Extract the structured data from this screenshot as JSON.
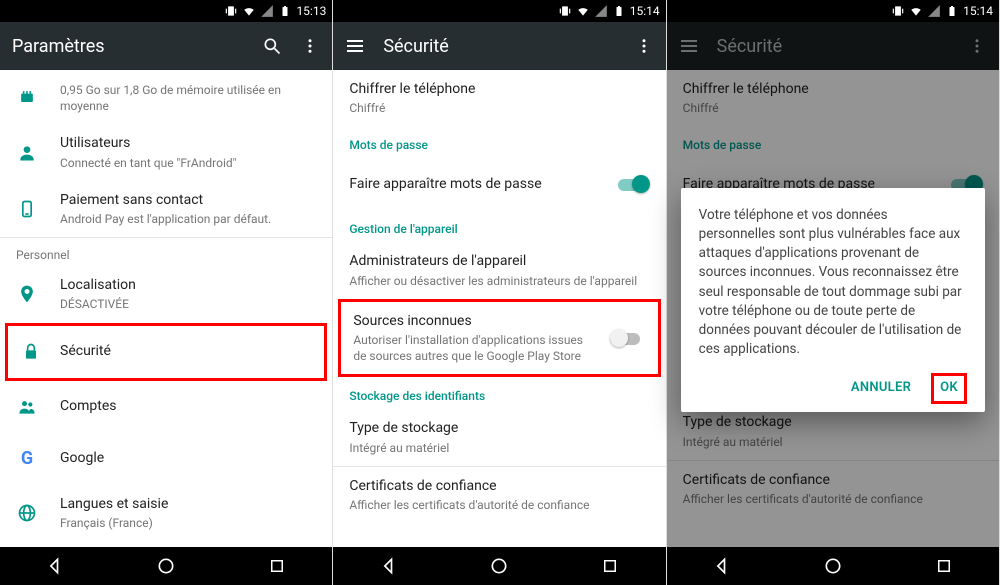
{
  "status": {
    "time1": "15:13",
    "time2": "15:14",
    "time3": "15:14"
  },
  "phone1": {
    "appbar_title": "Paramètres",
    "memory_sub": "0,95 Go sur 1,8 Go de mémoire utilisée en moyenne",
    "users_title": "Utilisateurs",
    "users_sub": "Connecté en tant que \"FrAndroid\"",
    "nfc_title": "Paiement sans contact",
    "nfc_sub": "Android Pay est l'application par défaut.",
    "section_personnel": "Personnel",
    "location_title": "Localisation",
    "location_sub": "DÉSACTIVÉE",
    "security_title": "Sécurité",
    "accounts_title": "Comptes",
    "google_title": "Google",
    "lang_title": "Langues et saisie",
    "lang_sub": "Français (France)"
  },
  "phone2": {
    "appbar_title": "Sécurité",
    "encrypt_title": "Chiffrer le téléphone",
    "encrypt_sub": "Chiffré",
    "section_passwords": "Mots de passe",
    "showpw_title": "Faire apparaître mots de passe",
    "section_admin": "Gestion de l'appareil",
    "admins_title": "Administrateurs de l'appareil",
    "admins_sub": "Afficher ou désactiver les administrateurs de l'appareil",
    "unknown_title": "Sources inconnues",
    "unknown_sub": "Autoriser l'installation d'applications issues de sources autres que le Google Play Store",
    "section_creds": "Stockage des identifiants",
    "storage_title": "Type de stockage",
    "storage_sub": "Intégré au matériel",
    "certs_title": "Certificats de confiance",
    "certs_sub": "Afficher les certificats d'autorité de confiance"
  },
  "phone3": {
    "appbar_title": "Sécurité",
    "dialog_text": "Votre téléphone et vos données personnelles sont plus vulnérables face aux attaques d'applications provenant de sources inconnues. Vous reconnaissez être seul responsable de tout dommage subi par votre téléphone ou de toute perte de données pouvant découler de l'utilisation de ces applications.",
    "cancel": "ANNULER",
    "ok": "OK"
  }
}
